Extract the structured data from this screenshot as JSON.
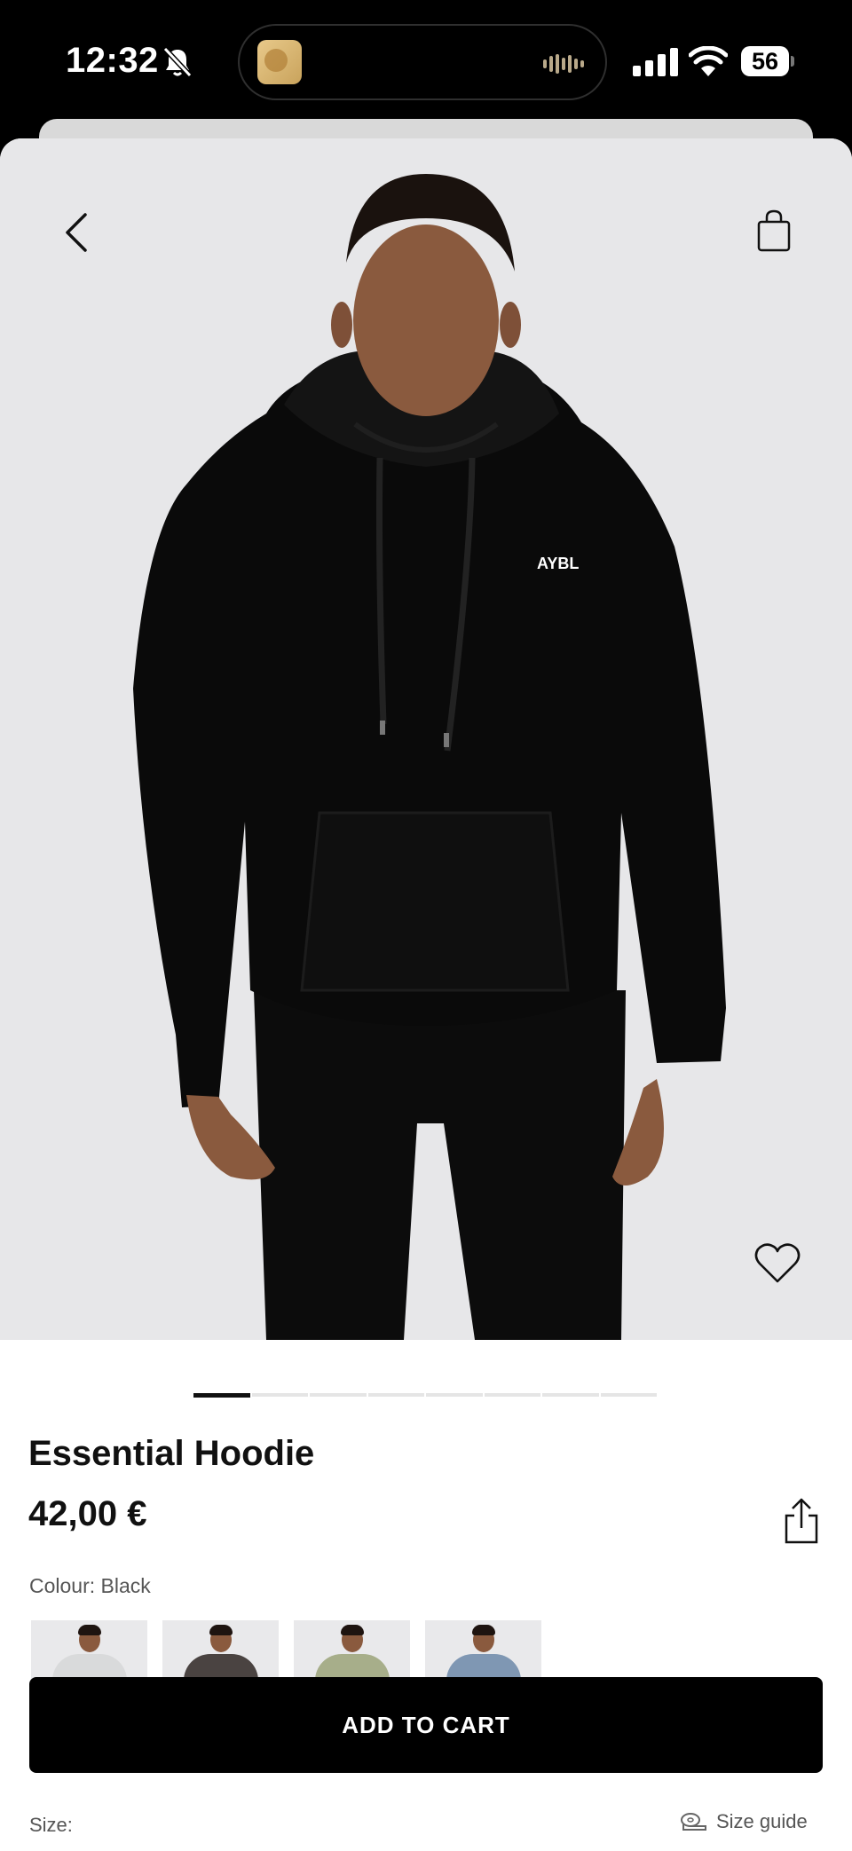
{
  "status_bar": {
    "time": "12:32",
    "battery": "56",
    "icons": [
      "bell-slash-icon",
      "waveform-icon",
      "cellular-signal-icon",
      "wifi-icon",
      "battery-icon"
    ]
  },
  "header": {
    "back_icon": "chevron-left-icon",
    "bag_icon": "shopping-bag-icon"
  },
  "product": {
    "title": "Essential Hoodie",
    "price": "42,00 €",
    "colour_label": "Colour: Black",
    "brand_mark": "AYBL",
    "image_count": 8,
    "active_image": 1,
    "swatch_colors": [
      "#d9dadb",
      "#4a4341",
      "#a7ae8a",
      "#7f97b3"
    ]
  },
  "actions": {
    "add_to_cart_label": "ADD TO CART",
    "favorite_icon": "heart-icon",
    "share_icon": "share-icon"
  },
  "size": {
    "label": "Size:",
    "guide_label": "Size guide",
    "guide_icon": "tape-measure-icon"
  },
  "colors": {
    "primary": "#000000",
    "image_background": "#e7e7e9",
    "text_muted": "#555555"
  }
}
